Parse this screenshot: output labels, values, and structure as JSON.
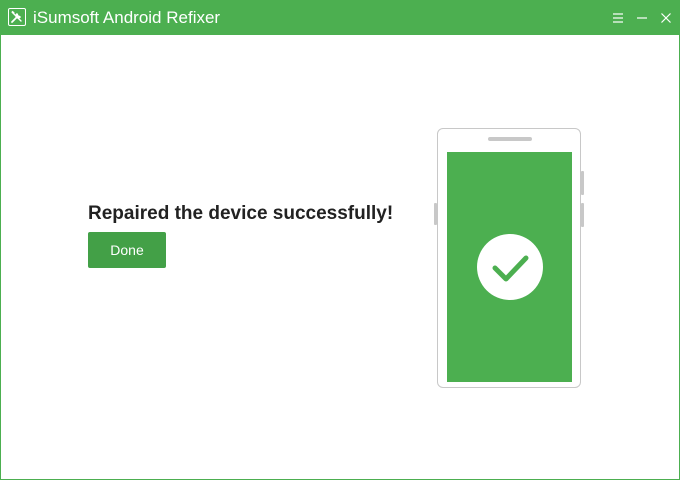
{
  "window": {
    "title": "iSumsoft Android Refixer",
    "app_icon": "tools-icon",
    "controls": [
      "menu-icon",
      "minimize-icon",
      "close-icon"
    ]
  },
  "main": {
    "message": "Repaired the device successfully!",
    "done_label": "Done"
  },
  "illustration": {
    "device": "phone",
    "status_icon": "checkmark-icon"
  },
  "colors": {
    "accent": "#4caf50",
    "button": "#43a047",
    "text": "#222222",
    "phone_outline": "#c8c8c8"
  }
}
